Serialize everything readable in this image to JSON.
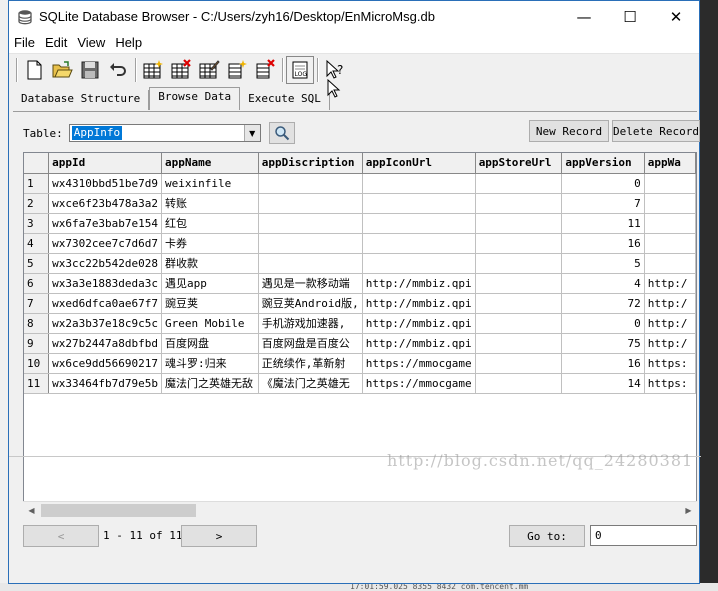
{
  "window": {
    "title": "SQLite Database Browser - C:/Users/zyh16/Desktop/EnMicroMsg.db",
    "minimize": "—",
    "maximize": "☐",
    "close": "✕"
  },
  "menu": [
    "File",
    "Edit",
    "View",
    "Help"
  ],
  "tabs": [
    "Database Structure",
    "Browse Data",
    "Execute SQL"
  ],
  "active_tab": "Browse Data",
  "browse": {
    "table_label": "Table:",
    "table_value": "AppInfo",
    "new_record": "New Record",
    "delete_record": "Delete Record",
    "columns": [
      "appId",
      "appName",
      "appDiscription",
      "appIconUrl",
      "appStoreUrl",
      "appVersion",
      "appWa"
    ],
    "rows": [
      {
        "n": "1",
        "appId": "wx4310bbd51be7d9",
        "appName": "weixinfile",
        "appDiscription": "",
        "appIconUrl": "",
        "appStoreUrl": "",
        "appVersion": "0",
        "appWa": ""
      },
      {
        "n": "2",
        "appId": "wxce6f23b478a3a2",
        "appName": "转账",
        "appDiscription": "",
        "appIconUrl": "",
        "appStoreUrl": "",
        "appVersion": "7",
        "appWa": ""
      },
      {
        "n": "3",
        "appId": "wx6fa7e3bab7e154",
        "appName": "红包",
        "appDiscription": "",
        "appIconUrl": "",
        "appStoreUrl": "",
        "appVersion": "11",
        "appWa": ""
      },
      {
        "n": "4",
        "appId": "wx7302cee7c7d6d7",
        "appName": "卡券",
        "appDiscription": "",
        "appIconUrl": "",
        "appStoreUrl": "",
        "appVersion": "16",
        "appWa": ""
      },
      {
        "n": "5",
        "appId": "wx3cc22b542de028",
        "appName": "群收款",
        "appDiscription": "",
        "appIconUrl": "",
        "appStoreUrl": "",
        "appVersion": "5",
        "appWa": ""
      },
      {
        "n": "6",
        "appId": "wx3a3e1883deda3c",
        "appName": "遇见app",
        "appDiscription": "遇见是一款移动端",
        "appIconUrl": "http://mmbiz.qpi",
        "appStoreUrl": "",
        "appVersion": "4",
        "appWa": "http:/"
      },
      {
        "n": "7",
        "appId": "wxed6dfca0ae67f7",
        "appName": "豌豆荚",
        "appDiscription": "豌豆荚Android版,",
        "appIconUrl": "http://mmbiz.qpi",
        "appStoreUrl": "",
        "appVersion": "72",
        "appWa": "http:/"
      },
      {
        "n": "8",
        "appId": "wx2a3b37e18c9c5c",
        "appName": "Green Mobile",
        "appDiscription": "手机游戏加速器,",
        "appIconUrl": "http://mmbiz.qpi",
        "appStoreUrl": "",
        "appVersion": "0",
        "appWa": "http:/"
      },
      {
        "n": "9",
        "appId": "wx27b2447a8dbfbd",
        "appName": "百度网盘",
        "appDiscription": "百度网盘是百度公",
        "appIconUrl": "http://mmbiz.qpi",
        "appStoreUrl": "",
        "appVersion": "75",
        "appWa": "http:/"
      },
      {
        "n": "10",
        "appId": "wx6ce9dd56690217",
        "appName": "魂斗罗:归来",
        "appDiscription": "正统续作,革新射",
        "appIconUrl": "https://mmocgame",
        "appStoreUrl": "",
        "appVersion": "16",
        "appWa": "https:"
      },
      {
        "n": "11",
        "appId": "wx33464fb7d79e5b",
        "appName": "魔法门之英雄无敌",
        "appDiscription": "《魔法门之英雄无",
        "appIconUrl": "https://mmocgame",
        "appStoreUrl": "",
        "appVersion": "14",
        "appWa": "https:"
      }
    ],
    "prev": "<",
    "next": ">",
    "range": "1 - 11 of 11",
    "goto_label": "Go to:",
    "goto_value": "0"
  },
  "watermark": "http://blog.csdn.net/qq_24280381",
  "background_text": "17:01:59.025    8355    8432    com.tencent.mm",
  "colors": {
    "accent": "#0078d7",
    "window_border": "#2a6fb8",
    "chrome": "#f0f0f0"
  },
  "icons": [
    "database-icon",
    "new-file-icon",
    "open-folder-icon",
    "save-icon",
    "undo-icon",
    "create-table-icon",
    "delete-table-icon",
    "modify-table-icon",
    "create-index-icon",
    "delete-index-icon",
    "log-icon",
    "whats-this-icon",
    "search-icon"
  ]
}
